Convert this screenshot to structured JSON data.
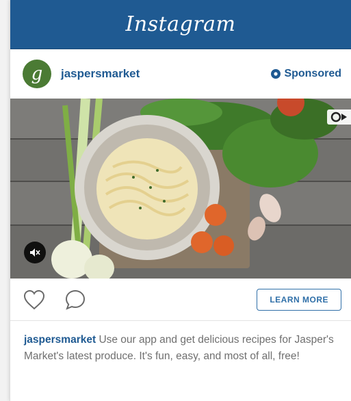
{
  "app": {
    "title": "Instagram"
  },
  "post": {
    "avatar_letter": "g",
    "username": "jaspersmarket",
    "sponsored_label": "Sponsored",
    "caption_user": "jaspersmarket",
    "caption_text": "Use our app and get delicious recipes for Jasper's Market's latest produce. It's fun, easy, and most of all, free!"
  },
  "actions": {
    "learn_more_label": "LEARN MORE"
  },
  "icons": {
    "like": "heart-outline-icon",
    "comment": "comment-bubble-icon",
    "sponsored": "gear-icon",
    "video": "video-camera-icon",
    "mute": "speaker-muted-icon"
  },
  "colors": {
    "brand_bar": "#1f5a92",
    "link": "#1f5a92",
    "button_border": "#2f6fa8",
    "avatar": "#4b7b34"
  }
}
